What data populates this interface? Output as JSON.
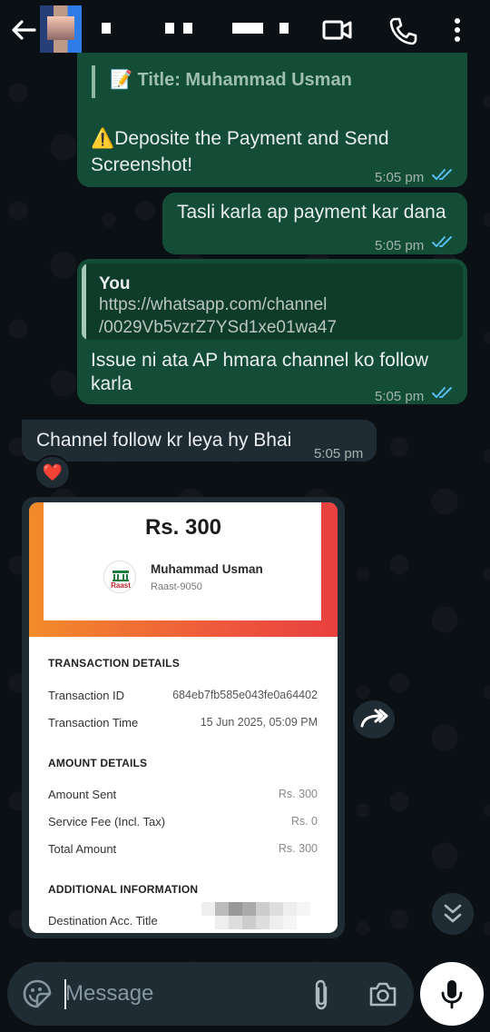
{
  "header": {
    "back_icon": "back-arrow-icon",
    "video_icon": "video-call-icon",
    "call_icon": "voice-call-icon",
    "menu_icon": "more-vert-icon"
  },
  "messages": [
    {
      "id": "m1",
      "direction": "outgoing",
      "title_line": "📝 Title: Muhammad Usman",
      "body": "⚠️Deposite the Payment and Send Screenshot!",
      "time": "5:05 pm",
      "status": "read"
    },
    {
      "id": "m2",
      "direction": "outgoing",
      "body": "Tasli karla ap payment kar dana",
      "time": "5:05 pm",
      "status": "read"
    },
    {
      "id": "m3",
      "direction": "outgoing",
      "quote_author": "You",
      "quote_text_1": "https://whatsapp.com/channel",
      "quote_text_2": "/0029Vb5vzrZ7YSd1xe01wa47",
      "body_1": "Issue ni ata AP hmara channel ko follow",
      "body_2": "karla",
      "time": "5:05 pm",
      "status": "read"
    },
    {
      "id": "m4",
      "direction": "incoming",
      "body": "Channel follow kr leya hy Bhai",
      "time": "5:05 pm",
      "reaction": "❤️"
    }
  ],
  "receipt": {
    "amount": "Rs. 300",
    "payee_name": "Muhammad Usman",
    "payee_account": "Raast-9050",
    "logo_text": "Raast",
    "transaction_heading": "TRANSACTION DETAILS",
    "transaction_id_label": "Transaction ID",
    "transaction_id_value": "684eb7fb585e043fe0a64402",
    "transaction_time_label": "Transaction Time",
    "transaction_time_value": "15 Jun 2025, 05:09 PM",
    "amount_heading": "AMOUNT DETAILS",
    "amount_sent_label": "Amount Sent",
    "amount_sent_value": "Rs. 300",
    "service_fee_label": "Service Fee (Incl. Tax)",
    "service_fee_value": "Rs. 0",
    "total_label": "Total Amount",
    "total_value": "Rs. 300",
    "additional_heading": "ADDITIONAL INFORMATION",
    "dest_title_label": "Destination Acc. Title"
  },
  "composer": {
    "placeholder": "Message",
    "emoji_icon": "emoji-icon",
    "attach_icon": "attach-icon",
    "camera_icon": "camera-icon",
    "mic_icon": "mic-icon"
  },
  "colors": {
    "outgoing_bubble": "#144d37",
    "incoming_bubble": "#202c33",
    "read_ticks": "#53bdeb",
    "background": "#0b1014"
  }
}
